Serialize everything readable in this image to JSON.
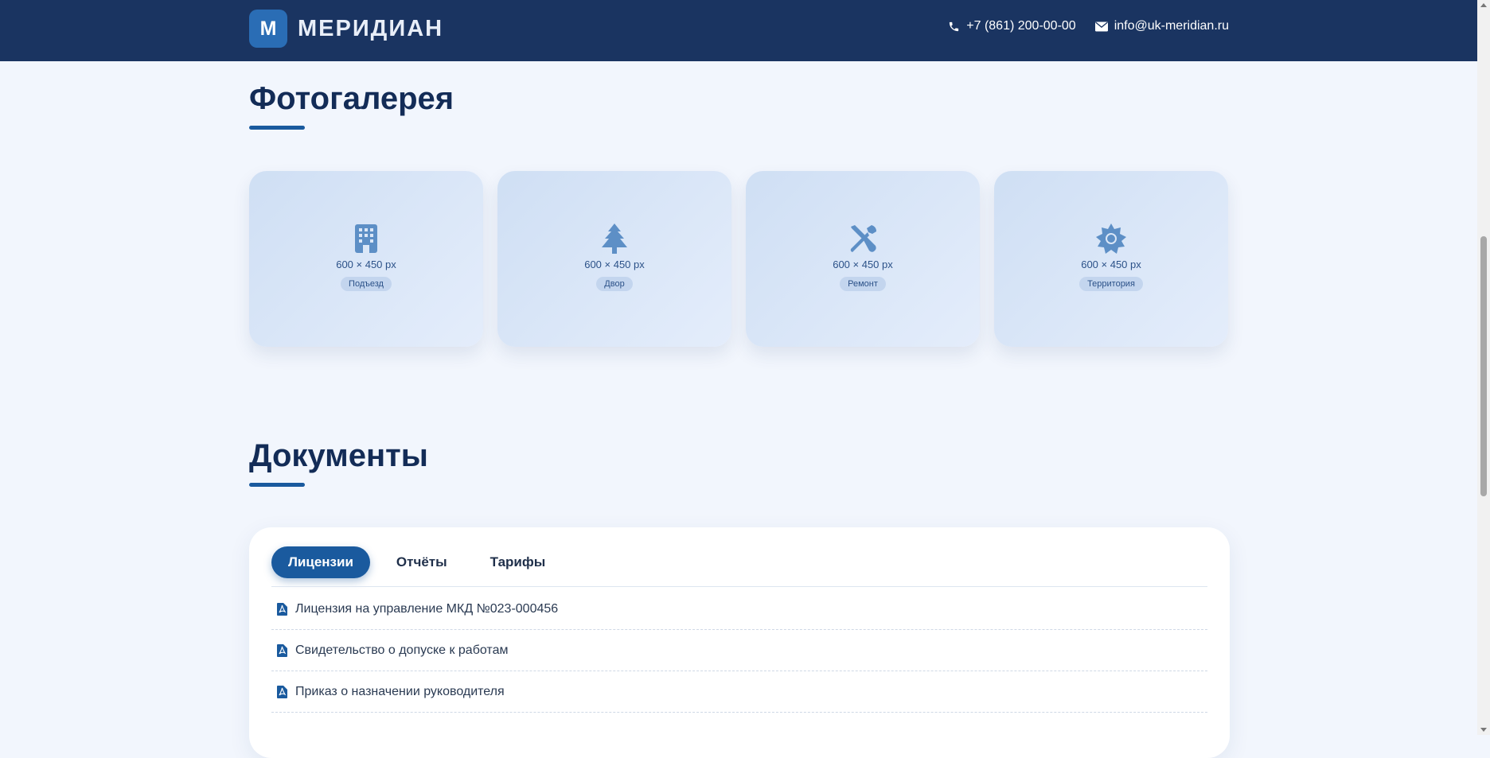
{
  "header": {
    "logo_letter": "М",
    "brand": "МЕРИДИАН",
    "phone": "+7 (861) 200-00-00",
    "email": "info@uk-meridian.ru",
    "phone_icon": "phone-icon",
    "email_icon": "envelope-icon"
  },
  "gallery": {
    "title": "Фотогалерея",
    "cards": [
      {
        "icon": "building-icon",
        "size": "600 × 450 px",
        "tag": "Подъезд"
      },
      {
        "icon": "tree-icon",
        "size": "600 × 450 px",
        "tag": "Двор"
      },
      {
        "icon": "tools-icon",
        "size": "600 × 450 px",
        "tag": "Ремонт"
      },
      {
        "icon": "sun-icon",
        "size": "600 × 450 px",
        "tag": "Территория"
      }
    ]
  },
  "documents": {
    "title": "Документы",
    "tabs": [
      {
        "label": "Лицензии",
        "active": true
      },
      {
        "label": "Отчёты",
        "active": false
      },
      {
        "label": "Тарифы",
        "active": false
      }
    ],
    "items": [
      {
        "icon": "pdf-file-icon",
        "label": "Лицензия на управление МКД №023-000456"
      },
      {
        "icon": "pdf-file-icon",
        "label": "Свидетельство о допуске к работам"
      },
      {
        "icon": "pdf-file-icon",
        "label": "Приказ о назначении руководителя"
      }
    ]
  },
  "colors": {
    "header_bg": "#1a3461",
    "accent": "#1a5a9e",
    "page_bg": "#f2f6fd",
    "card_icon": "#5d8fc6"
  }
}
